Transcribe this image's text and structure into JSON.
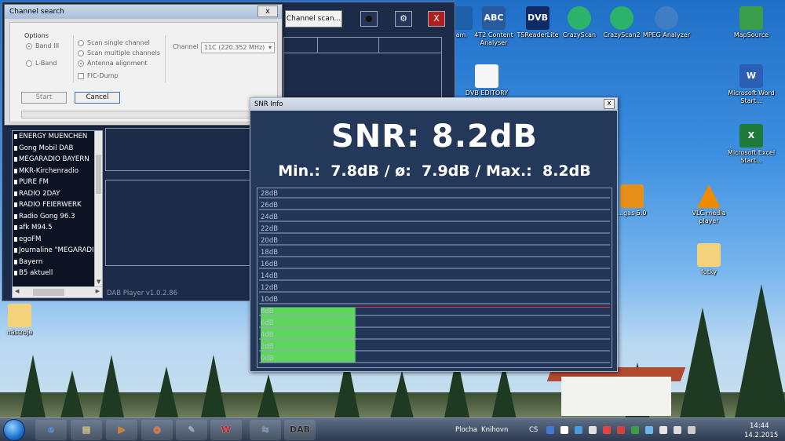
{
  "desktop": {
    "icons": [
      {
        "id": "am",
        "label": "am",
        "color": "#1d5fa8",
        "glyph": ""
      },
      {
        "id": "4t2",
        "label": "4T2 Content Analyser",
        "color": "#2a5a9e",
        "glyph": "ABC"
      },
      {
        "id": "tsreader",
        "label": "TSReaderLite",
        "color": "#102a66",
        "glyph": "DVB"
      },
      {
        "id": "crazyscan",
        "label": "CrazyScan",
        "color": "#2bb36a",
        "glyph": ""
      },
      {
        "id": "crazyscan2",
        "label": "CrazyScan2",
        "color": "#2bb36a",
        "glyph": ""
      },
      {
        "id": "mpeg",
        "label": "MPEG Analyzer",
        "color": "#3f7dc5",
        "glyph": ""
      },
      {
        "id": "mapsource",
        "label": "MapSource",
        "color": "#3a9d4a",
        "glyph": ""
      },
      {
        "id": "dvbeditor",
        "label": "DVB EDITORY SAT",
        "color": "#f6f6f6",
        "glyph": ""
      },
      {
        "id": "word",
        "label": "Microsoft Word Start...",
        "color": "#2b5fb3",
        "glyph": "W"
      },
      {
        "id": "excel",
        "label": "Microsoft Excel Start...",
        "color": "#1f7a3a",
        "glyph": "X"
      },
      {
        "id": "nas",
        "label": "...gas 5.0",
        "color": "#e6901a",
        "glyph": ""
      },
      {
        "id": "vlc",
        "label": "VLC media player",
        "color": "#f08a00",
        "glyph": ""
      },
      {
        "id": "fotky",
        "label": "fotky",
        "color": "#f3d27a",
        "glyph": ""
      },
      {
        "id": "nastroje",
        "label": "nástroje",
        "color": "#f3d27a",
        "glyph": ""
      }
    ]
  },
  "dab_window": {
    "scan_label": "Channel scan...",
    "close_label": "X",
    "version": "DAB Player v1.0.2.86",
    "stations": [
      "ENERGY MUENCHEN",
      "Gong Mobil DAB",
      "MEGARADIO BAYERN",
      "MKR-Kirchenradio",
      "PURE FM",
      "RADIO 2DAY",
      "RADIO FEIERWERK",
      "Radio Gong 96.3",
      "afk M94.5",
      "egoFM",
      "Journaline \"MEGARADI",
      "Bayern",
      "B5 aktuell"
    ]
  },
  "channel_dialog": {
    "title": "Channel search",
    "close": "x",
    "options_label": "Options",
    "band3": "Band III",
    "lband": "L-Band",
    "scan_single": "Scan single channel",
    "scan_multiple": "Scan multiple channels",
    "antenna": "Antenna alignment",
    "fic": "FIC-Dump",
    "channel_label": "Channel",
    "channel_value": "11C (220.352 MHz)",
    "start": "Start",
    "cancel": "Cancel"
  },
  "snr_window": {
    "title": "SNR Info",
    "close": "x",
    "value_text": "SNR:  8.2dB",
    "stats_text": "Min.:  7.8dB / ø:  7.9dB / Max.:  8.2dB",
    "graph": {
      "y_labels": [
        "28dB",
        "26dB",
        "24dB",
        "22dB",
        "20dB",
        "18dB",
        "16dB",
        "14dB",
        "12dB",
        "10dB",
        "8dB",
        "6dB",
        "4dB",
        "2dB",
        "0dB"
      ],
      "current_level_db": 8.2,
      "y_max_db": 28,
      "fill_fraction_x": 0.27,
      "bar_color": "#5ed65e",
      "line_color": "#e23b3b"
    }
  },
  "taskbar": {
    "desktop_label": "Plocha",
    "library_label": "Knihovn",
    "lang": "CS",
    "time": "14:44",
    "date": "14.2.2015",
    "apps": [
      {
        "id": "ie",
        "glyph": "e",
        "color": "#2d7fd6"
      },
      {
        "id": "explorer",
        "glyph": "▤",
        "color": "#e6c04f"
      },
      {
        "id": "media",
        "glyph": "▶",
        "color": "#e07b1e"
      },
      {
        "id": "firefox",
        "glyph": "◉",
        "color": "#e0661e"
      },
      {
        "id": "paint",
        "glyph": "✎",
        "color": "#8aa9c9"
      },
      {
        "id": "w",
        "glyph": "W",
        "color": "#c0202a"
      },
      {
        "id": "network",
        "glyph": "⇆",
        "color": "#6d8fb5"
      },
      {
        "id": "dab",
        "glyph": "DAB",
        "color": "#2a2a2a"
      }
    ]
  }
}
